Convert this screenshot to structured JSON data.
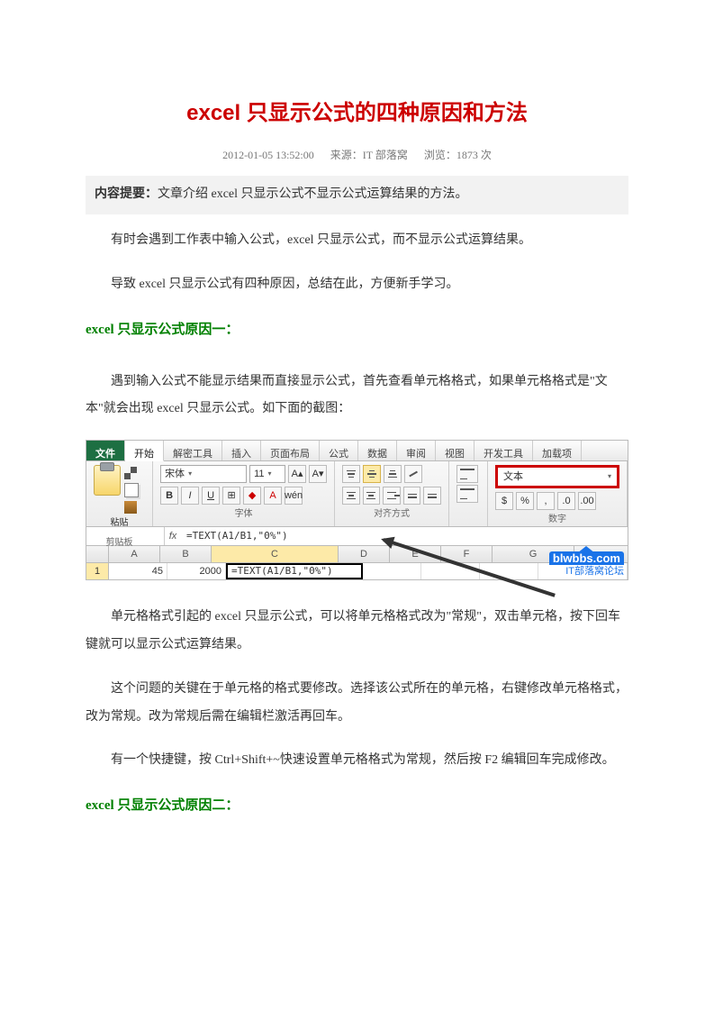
{
  "title": "excel 只显示公式的四种原因和方法",
  "meta": {
    "datetime": "2012-01-05 13:52:00",
    "source_label": "来源：",
    "source": "IT 部落窝",
    "views_label": "浏览：",
    "views": "1873 次"
  },
  "summary": {
    "label": "内容提要：",
    "text": "文章介绍 excel 只显示公式不显示公式运算结果的方法。"
  },
  "intro": "有时会遇到工作表中输入公式，excel 只显示公式，而不显示公式运算结果。",
  "para_lead": "导致 excel 只显示公式有四种原因，总结在此，方便新手学习。",
  "section1": {
    "heading": "excel 只显示公式原因一：",
    "p1": "遇到输入公式不能显示结果而直接显示公式，首先查看单元格格式，如果单元格格式是\"文本\"就会出现 excel 只显示公式。如下面的截图：",
    "p2": "单元格格式引起的 excel 只显示公式，可以将单元格格式改为\"常规\"，双击单元格，按下回车键就可以显示公式运算结果。",
    "p3": "这个问题的关键在于单元格的格式要修改。选择该公式所在的单元格，右键修改单元格格式，改为常规。改为常规后需在编辑栏激活再回车。",
    "p4": "有一个快捷键，按 Ctrl+Shift+~快速设置单元格格式为常规，然后按 F2 编辑回车完成修改。"
  },
  "section2": {
    "heading": "excel 只显示公式原因二："
  },
  "excel": {
    "tabs": {
      "file": "文件",
      "home": "开始",
      "secure": "解密工具",
      "insert": "插入",
      "layout": "页面布局",
      "formula": "公式",
      "data": "数据",
      "review": "审阅",
      "view": "视图",
      "dev": "开发工具",
      "addin": "加载项"
    },
    "groups": {
      "clipboard": "剪贴板",
      "paste": "粘贴",
      "font": "字体",
      "align": "对齐方式",
      "number": "数字"
    },
    "font": {
      "name": "宋体",
      "size": "11"
    },
    "number_format": "文本",
    "formula_bar": "=TEXT(A1/B1,\"0%\")",
    "cols": [
      "A",
      "B",
      "C",
      "D",
      "E",
      "F",
      "G"
    ],
    "row1": {
      "A": "45",
      "B": "2000",
      "C": "=TEXT(A1/B1,\"0%\")"
    },
    "watermark_logo": "blwbbs.com",
    "watermark_text": "IT部落窝论坛"
  }
}
